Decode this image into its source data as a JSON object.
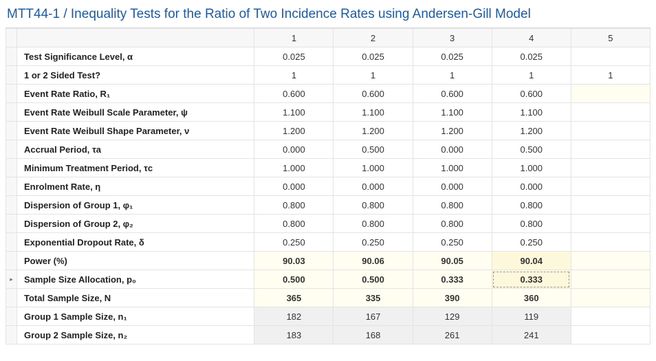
{
  "title": "MTT44-1 / Inequality Tests for the Ratio of Two Incidence Rates using Andersen-Gill Model",
  "columns": [
    "1",
    "2",
    "3",
    "4",
    "5"
  ],
  "rows": [
    {
      "label": "Test Significance Level, α",
      "vals": [
        "0.025",
        "0.025",
        "0.025",
        "0.025",
        ""
      ],
      "style": "plain"
    },
    {
      "label": "1 or 2 Sided Test?",
      "vals": [
        "1",
        "1",
        "1",
        "1",
        "1"
      ],
      "style": "plain"
    },
    {
      "label": "Event Rate Ratio, R₁",
      "vals": [
        "0.600",
        "0.600",
        "0.600",
        "0.600",
        ""
      ],
      "style": "hl5"
    },
    {
      "label": "Event Rate Weibull Scale Parameter, ψ",
      "vals": [
        "1.100",
        "1.100",
        "1.100",
        "1.100",
        ""
      ],
      "style": "plain"
    },
    {
      "label": "Event Rate Weibull Shape Parameter, ν",
      "vals": [
        "1.200",
        "1.200",
        "1.200",
        "1.200",
        ""
      ],
      "style": "plain"
    },
    {
      "label": "Accrual Period, τa",
      "vals": [
        "0.000",
        "0.500",
        "0.000",
        "0.500",
        ""
      ],
      "style": "plain"
    },
    {
      "label": "Minimum Treatment Period, τc",
      "vals": [
        "1.000",
        "1.000",
        "1.000",
        "1.000",
        ""
      ],
      "style": "plain"
    },
    {
      "label": "Enrolment Rate, η",
      "vals": [
        "0.000",
        "0.000",
        "0.000",
        "0.000",
        ""
      ],
      "style": "plain"
    },
    {
      "label": "Dispersion of Group 1, φ₁",
      "vals": [
        "0.800",
        "0.800",
        "0.800",
        "0.800",
        ""
      ],
      "style": "plain"
    },
    {
      "label": "Dispersion of Group 2, φ₂",
      "vals": [
        "0.800",
        "0.800",
        "0.800",
        "0.800",
        ""
      ],
      "style": "plain"
    },
    {
      "label": "Exponential Dropout Rate, δ",
      "vals": [
        "0.250",
        "0.250",
        "0.250",
        "0.250",
        ""
      ],
      "style": "plain"
    },
    {
      "label": "Power (%)",
      "vals": [
        "90.03",
        "90.06",
        "90.05",
        "90.04",
        ""
      ],
      "style": "power"
    },
    {
      "label": "Sample Size Allocation, p₀",
      "vals": [
        "0.500",
        "0.500",
        "0.333",
        "0.333",
        ""
      ],
      "style": "alloc",
      "handle": "▸"
    },
    {
      "label": "Total Sample Size, N",
      "vals": [
        "365",
        "335",
        "390",
        "360",
        ""
      ],
      "style": "total"
    },
    {
      "label": "Group 1 Sample Size, n₁",
      "vals": [
        "182",
        "167",
        "129",
        "119",
        ""
      ],
      "style": "gray"
    },
    {
      "label": "Group 2 Sample Size, n₂",
      "vals": [
        "183",
        "168",
        "261",
        "241",
        ""
      ],
      "style": "gray"
    }
  ]
}
